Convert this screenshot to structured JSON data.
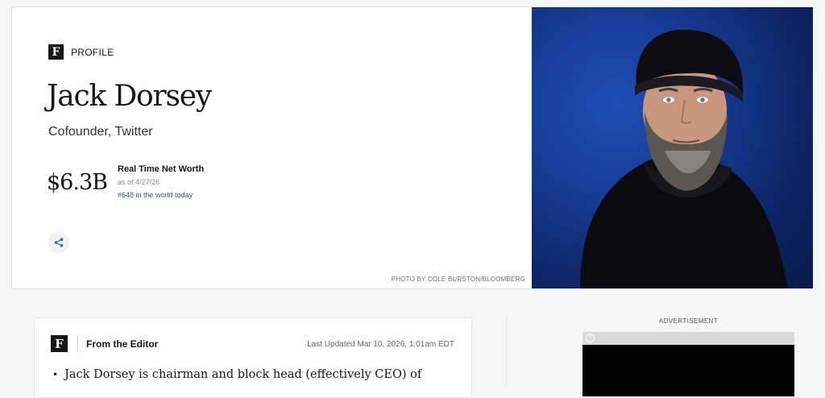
{
  "profile": {
    "badge": "PROFILE",
    "logo_letter": "F",
    "name": "Jack Dorsey",
    "title": "Cofounder, Twitter",
    "net_worth": "$6.3B",
    "net_worth_label": "Real Time Net Worth",
    "as_of": "as of 4/27/26",
    "rank": "#648 in the world today",
    "photo_credit": "PHOTO BY COLE BURSTON/BLOOMBERG"
  },
  "editor": {
    "logo_letter": "F",
    "title": "From the Editor",
    "updated": "Last Updated Mar 10, 2026, 1:01am EDT",
    "bullet": "Jack Dorsey is chairman and block head (effectively CEO) of"
  },
  "ad": {
    "label": "ADVERTISEMENT",
    "info_icon": "?"
  },
  "colors": {
    "accent_link": "#2b5a9a",
    "photo_bg": "#163c95"
  }
}
